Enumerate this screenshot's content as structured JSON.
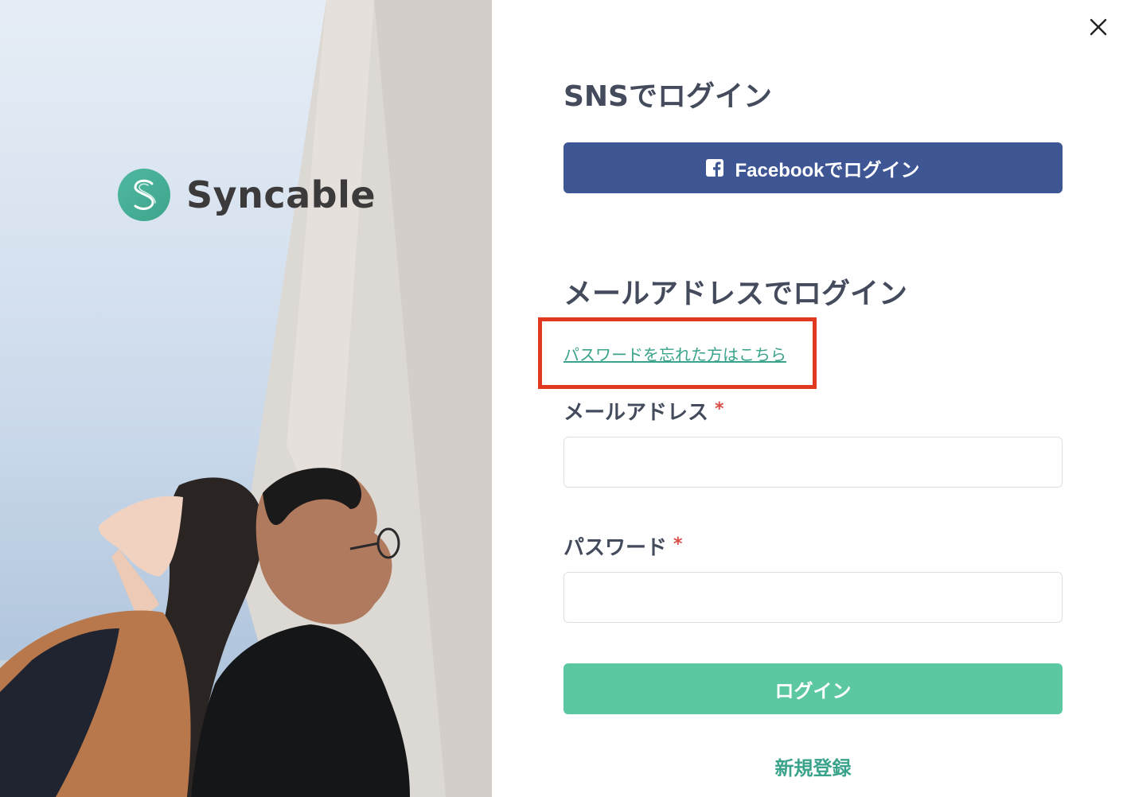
{
  "brand": {
    "name": "Syncable"
  },
  "sns_section": {
    "heading": "SNSでログイン",
    "facebook_button": "Facebookでログイン"
  },
  "email_section": {
    "heading": "メールアドレスでログイン",
    "forgot_password_link": "パスワードを忘れた方はこちら",
    "email_label": "メールアドレス",
    "password_label": "パスワード",
    "required_mark": "*",
    "email_value": "",
    "password_value": ""
  },
  "login_button": "ログイン",
  "signup_link": "新規登録",
  "icons": {
    "close": "close-icon",
    "facebook": "facebook-icon",
    "logo": "syncable-logo-icon"
  },
  "colors": {
    "facebook": "#3f5695",
    "primary": "#5cc8a1",
    "link": "#3aa38b",
    "heading": "#434b5c",
    "required": "#d94b45",
    "highlight": "#e0391f"
  }
}
